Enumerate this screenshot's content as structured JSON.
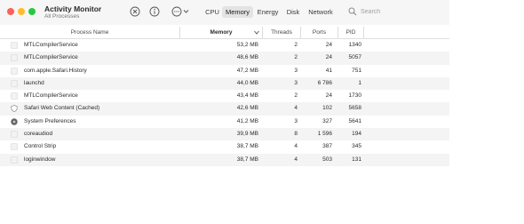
{
  "window": {
    "title": "Activity Monitor",
    "subtitle": "All Processes"
  },
  "toolbar": {
    "icons": [
      "stop-icon",
      "info-icon",
      "action-icon",
      "chevron-down-icon"
    ],
    "tabs": [
      {
        "label": "CPU",
        "selected": false
      },
      {
        "label": "Memory",
        "selected": true
      },
      {
        "label": "Energy",
        "selected": false
      },
      {
        "label": "Disk",
        "selected": false
      },
      {
        "label": "Network",
        "selected": false
      }
    ],
    "search": {
      "placeholder": "Search",
      "value": ""
    }
  },
  "table": {
    "columns": {
      "name": "Process Name",
      "memory": "Memory",
      "threads": "Threads",
      "ports": "Ports",
      "pid": "PID"
    },
    "sort": {
      "column": "memory",
      "direction": "descending"
    },
    "rows": [
      {
        "name": "MTLCompilerService",
        "icon": "blank-document-icon",
        "memory": "53,2 MB",
        "threads": "2",
        "ports": "24",
        "pid": "1340"
      },
      {
        "name": "MTLCompilerService",
        "icon": "blank-document-icon",
        "memory": "48,6 MB",
        "threads": "2",
        "ports": "24",
        "pid": "5057"
      },
      {
        "name": "com.apple.Safari.History",
        "icon": "blank-document-icon",
        "memory": "47,2 MB",
        "threads": "3",
        "ports": "41",
        "pid": "751"
      },
      {
        "name": "launchd",
        "icon": "blank-document-icon",
        "memory": "44,0 MB",
        "threads": "3",
        "ports": "6 786",
        "pid": "1"
      },
      {
        "name": "MTLCompilerService",
        "icon": "blank-document-icon",
        "memory": "43,4 MB",
        "threads": "2",
        "ports": "24",
        "pid": "1730"
      },
      {
        "name": "Safari Web Content (Cached)",
        "icon": "shield-icon",
        "memory": "42,6 MB",
        "threads": "4",
        "ports": "102",
        "pid": "5658"
      },
      {
        "name": "System Preferences",
        "icon": "gear-icon",
        "memory": "41,2 MB",
        "threads": "3",
        "ports": "327",
        "pid": "5641"
      },
      {
        "name": "coreaudiod",
        "icon": "blank-document-icon",
        "memory": "39,9 MB",
        "threads": "8",
        "ports": "1 596",
        "pid": "194"
      },
      {
        "name": "Control Strip",
        "icon": "blank-document-icon",
        "memory": "38,7 MB",
        "threads": "4",
        "ports": "387",
        "pid": "345"
      },
      {
        "name": "loginwindow",
        "icon": "blank-document-icon",
        "memory": "38,7 MB",
        "threads": "4",
        "ports": "503",
        "pid": "131"
      }
    ]
  },
  "colors": {
    "close": "#ff5f57",
    "minimize": "#febc2e",
    "zoom": "#28c840",
    "selected_tab": "#e3e3e3",
    "alternate_row": "#f4f4f5"
  }
}
